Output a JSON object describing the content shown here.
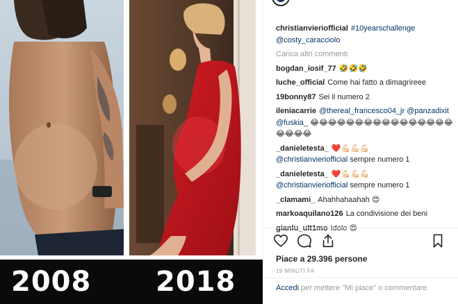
{
  "collage": {
    "year_left": "2008",
    "year_right": "2018",
    "colors": {
      "dress": "#c8141c",
      "caption_bar": "#0a0a0a"
    }
  },
  "post": {
    "author": "christianvieriofficial",
    "caption_hashtag": "#10yearschallenge",
    "caption_mention": "@costy_caracciolo",
    "load_more": "Carica altri commenti",
    "comments": [
      {
        "user": "bogdan_iosif_77",
        "text": "🤣🤣🤣"
      },
      {
        "user": "luche_official",
        "text": "Come hai fatto a dimagrireee"
      },
      {
        "user": "19bonny87",
        "text": "Sei il numero 2"
      },
      {
        "user": "ileniacarrie",
        "mention1": "@thereal_francesco04_jr",
        "mention2": "@panzadixit",
        "mention3": "@fuskia_",
        "emoji_tail": "😂😂😂😂😂😂😂😂😂😂😂😂😂😂😂😂😂😂😂😂"
      },
      {
        "user": "_danieletesta_",
        "emoji": "❤️💪🏻💪🏻💪🏻",
        "mention": "@christianvieriofficial",
        "text": "sempre numero 1"
      },
      {
        "user": "_danieletesta_",
        "emoji": "❤️💪🏻💪🏻💪🏻",
        "mention": "@christianvieriofficial",
        "text": "sempre numero 1"
      },
      {
        "user": "_clamami_",
        "text": "Ahahhahaahah",
        "emoji": "😍"
      },
      {
        "user": "markoaquilano126",
        "text": "La condivisione dei beni"
      },
      {
        "user": "gianlu_ult1mo",
        "text": "Idolo",
        "emoji": "😍"
      }
    ],
    "likes": "Piace a 29.396 persone",
    "timestamp": "19 MINUTI FA",
    "login_link": "Accedi",
    "login_rest": " per mettere \"Mi piace\" o commentare."
  },
  "icons": {
    "like": "heart-outline-icon",
    "comment": "speech-bubble-icon",
    "share": "share-upload-icon",
    "save": "bookmark-icon"
  },
  "colors": {
    "link": "#003569",
    "muted": "#999999",
    "text": "#262626",
    "heart": "#ed4956"
  }
}
